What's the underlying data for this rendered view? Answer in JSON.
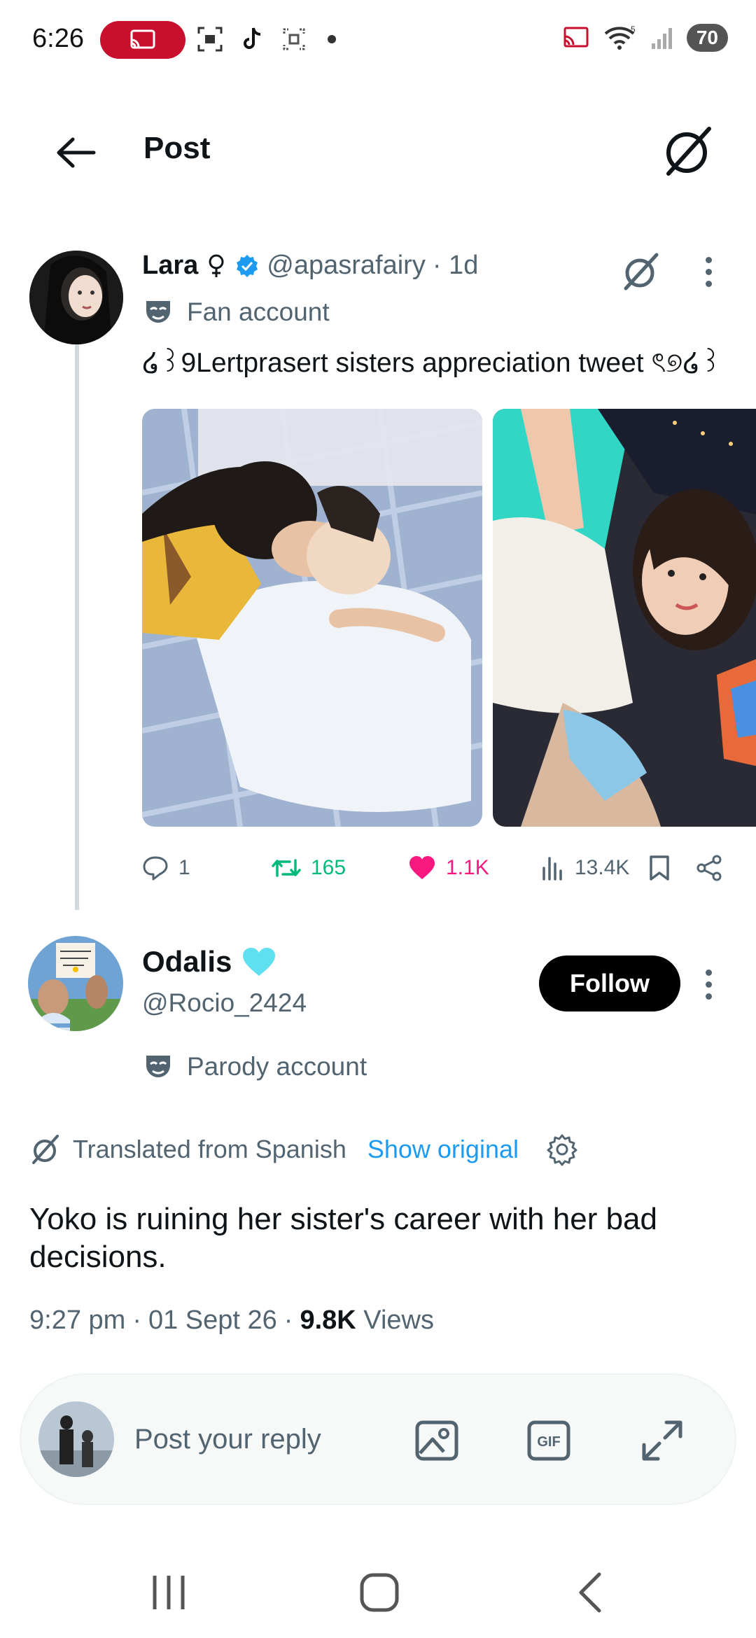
{
  "status_bar": {
    "time": "6:26",
    "battery": "70",
    "signal_label": "5"
  },
  "header": {
    "title": "Post"
  },
  "parent_tweet": {
    "name": "Lara",
    "handle": "@apasrafairy",
    "time": "· 1d",
    "label": "Fan account",
    "text": "໒꒱9Lertprasert sisters appreciation tweet ৎ୭໒꒱",
    "replies": "1",
    "reposts": "165",
    "likes": "1.1K",
    "views": "13.4K"
  },
  "main_tweet": {
    "name": "Odalis",
    "handle": "@Rocio_2424",
    "follow_label": "Follow",
    "label": "Parody account",
    "translated_label": "Translated from Spanish",
    "show_original": "Show original",
    "text": "Yoko is ruining her sister's career with her bad decisions.",
    "time": "9:27 pm",
    "date": "01 Sept 26",
    "views_count": "9.8K",
    "views_label": "Views"
  },
  "reply_bar": {
    "placeholder": "Post your reply",
    "gif_label": "GIF"
  },
  "colors": {
    "accent": "#1d9bf0",
    "repost": "#00ba7c",
    "like": "#f91880",
    "cast_badge": "#c8102e"
  }
}
